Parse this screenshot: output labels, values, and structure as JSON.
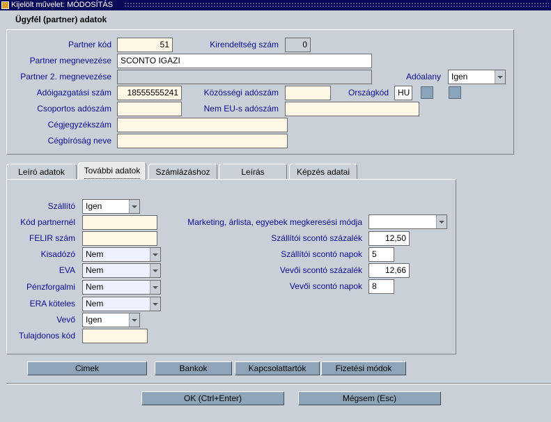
{
  "window": {
    "title": "Kijelölt művelet: MÓDOSÍTÁS"
  },
  "header": {
    "title": "Ügyfél (partner) adatok"
  },
  "partner": {
    "kod_label": "Partner kód",
    "kod_value": "51",
    "kirendeltseg_label": "Kirendeltség szám",
    "kirendeltseg_value": "0",
    "megnevezes_label": "Partner megnevezése",
    "megnevezes_value": "SCONTO IGAZI",
    "megnevezes2_label": "Partner 2. megnevezése",
    "megnevezes2_value": "",
    "adoalany_label": "Adóalany",
    "adoalany_value": "Igen",
    "adoigazgatasi_label": "Adóigazgatási szám",
    "adoigazgatasi_value": "18555555241",
    "kozossegi_label": "Közösségi adószám",
    "kozossegi_value": "",
    "orszagkod_label": "Országkód",
    "orszagkod_value": "HU",
    "csoportos_label": "Csoportos adószám",
    "csoportos_value": "",
    "nemeu_label": "Nem EU-s adószám",
    "nemeu_value": "",
    "cegjegyzek_label": "Cégjegyzékszám",
    "cegjegyzek_value": "",
    "cegbirosag_label": "Cégbíróság neve",
    "cegbirosag_value": ""
  },
  "tabs": [
    {
      "label": "Leíró adatok"
    },
    {
      "label": "További adatok"
    },
    {
      "label": "Számlázáshoz"
    },
    {
      "label": "Leírás"
    },
    {
      "label": "Képzés adatai"
    }
  ],
  "further": {
    "szallito_label": "Szállító",
    "szallito_value": "Igen",
    "kodpartner_label": "Kód partnernél",
    "kodpartner_value": "",
    "felir_label": "FELIR szám",
    "felir_value": "",
    "kisadozo_label": "Kisadózó",
    "kisadozo_value": "Nem",
    "eva_label": "EVA",
    "eva_value": "Nem",
    "penzforgalmi_label": "Pénzforgalmi",
    "penzforgalmi_value": "Nem",
    "era_label": "ERA köteles",
    "era_value": "Nem",
    "vevo_label": "Vevő",
    "vevo_value": "Igen",
    "tulajdonos_label": "Tulajdonos kód",
    "tulajdonos_value": "",
    "marketing_label": "Marketing, árlista, egyebek megkeresési módja",
    "marketing_value": "",
    "szall_szazalek_label": "Szállítói scontó százalék",
    "szall_szazalek_value": "12,50",
    "szall_napok_label": "Szállítói scontó napok",
    "szall_napok_value": "5",
    "vevo_szazalek_label": "Vevői scontó százalék",
    "vevo_szazalek_value": "12,66",
    "vevo_napok_label": "Vevői scontó napok",
    "vevo_napok_value": "8"
  },
  "buttons": {
    "cimek": "Cimek",
    "bankok": "Bankok",
    "kapcsolattartok": "Kapcsolattartók",
    "fizetesi": "Fizetési módok",
    "ok": "OK (Ctrl+Enter)",
    "megsem": "Mégsem (Esc)"
  }
}
